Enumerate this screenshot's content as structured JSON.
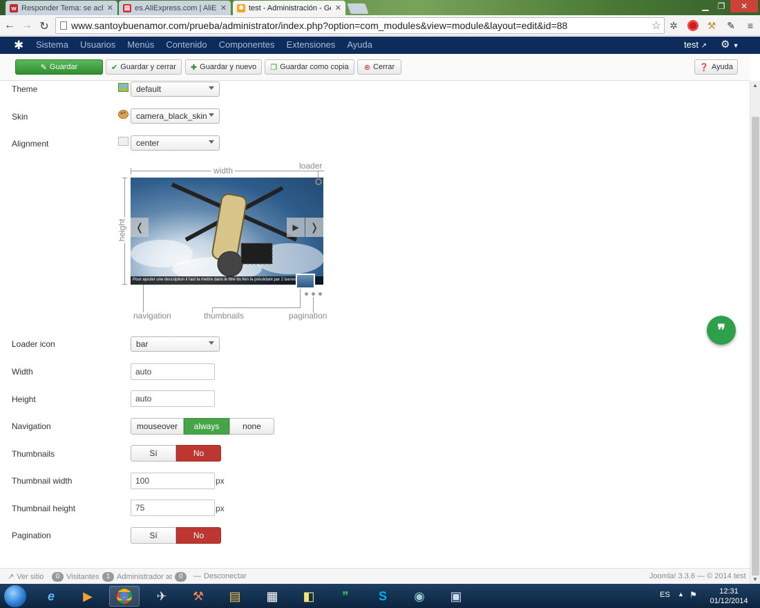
{
  "browser": {
    "tabs": [
      {
        "title": "Responder Tema: se achic",
        "favicon_color": "#c62828"
      },
      {
        "title": "es.AliExpress.com | AliExp",
        "favicon_color": "#d32f2f"
      },
      {
        "title": "test - Administración - Ge",
        "favicon_color": "#f5a623"
      }
    ],
    "url": "www.santoybuenamor.com/prueba/administrator/index.php?option=com_modules&view=module&layout=edit&id=88"
  },
  "admin_nav": {
    "menu": [
      "Sistema",
      "Usuarios",
      "Menús",
      "Contenido",
      "Componentes",
      "Extensiones",
      "Ayuda"
    ],
    "user": "test"
  },
  "toolbar": {
    "save": "Guardar",
    "save_close": "Guardar y cerrar",
    "save_new": "Guardar y nuevo",
    "save_copy": "Guardar como copia",
    "close": "Cerrar",
    "help": "Ayuda"
  },
  "form": {
    "theme": {
      "label": "Theme",
      "value": "default"
    },
    "skin": {
      "label": "Skin",
      "value": "camera_black_skin"
    },
    "alignment": {
      "label": "Alignment",
      "value": "center"
    },
    "diagram": {
      "width": "width",
      "loader": "loader",
      "height": "height",
      "navigation": "navigation",
      "thumbnails": "thumbnails",
      "pagination": "pagination",
      "caption": "Pour ajouter une description il faut la mettre dans le titre du lien la précédant par 2 barres verticales"
    },
    "loader_icon": {
      "label": "Loader icon",
      "value": "bar"
    },
    "width": {
      "label": "Width",
      "value": "auto"
    },
    "height": {
      "label": "Height",
      "value": "auto"
    },
    "navigation": {
      "label": "Navigation",
      "options": [
        "mouseover",
        "always",
        "none"
      ],
      "selected": "always"
    },
    "thumbnails": {
      "label": "Thumbnails",
      "options": [
        "Sí",
        "No"
      ],
      "selected": "No"
    },
    "thumbnail_width": {
      "label": "Thumbnail width",
      "value": "100",
      "unit": "px"
    },
    "thumbnail_height": {
      "label": "Thumbnail height",
      "value": "75",
      "unit": "px"
    },
    "pagination": {
      "label": "Pagination",
      "options": [
        "Sí",
        "No"
      ],
      "selected": "No"
    }
  },
  "status": {
    "view_site": "Ver sitio",
    "visitors_count": "0",
    "visitors": "Visitantes",
    "admin_count": "1",
    "admin": "Administrador",
    "messages_count": "0",
    "logout": "Desconectar",
    "version": "Joomla! 3.3.6 — © 2014 test"
  },
  "taskbar": {
    "lang": "ES",
    "time": "12:31",
    "date": "01/12/2014"
  },
  "colors": {
    "accent_green": "#46a546",
    "accent_red": "#bd362f",
    "nav_blue": "#0d2b5b"
  }
}
